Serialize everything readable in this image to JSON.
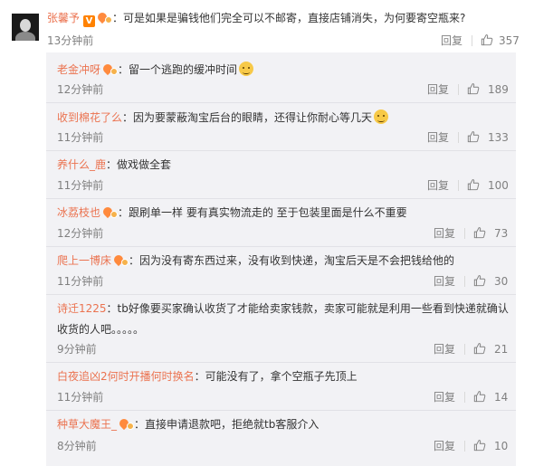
{
  "main": {
    "user": "张馨予",
    "verified_badge": "V",
    "text": "：可是如果是骗钱他们完全可以不邮寄，直接店铺消失，为何要寄空瓶来?",
    "time": "13分钟前",
    "reply_label": "回复",
    "likes": "357"
  },
  "replies": [
    {
      "user": "老金冲呀",
      "fan_badge": true,
      "text": "：留一个逃跑的缓冲时间",
      "emoji": "dog-emoji",
      "time": "12分钟前",
      "reply_label": "回复",
      "likes": "189"
    },
    {
      "user": "收到棉花了么",
      "fan_badge": false,
      "text": "：因为要蒙蔽淘宝后台的眼睛，还得让你耐心等几天",
      "emoji": "laugh-emoji",
      "time": "11分钟前",
      "reply_label": "回复",
      "likes": "133"
    },
    {
      "user": "养什么_鹿",
      "fan_badge": false,
      "text": "：做戏做全套",
      "emoji": null,
      "time": "11分钟前",
      "reply_label": "回复",
      "likes": "100"
    },
    {
      "user": "冰荔枝也",
      "fan_badge": true,
      "text": "：跟刷单一样 要有真实物流走的 至于包装里面是什么不重要",
      "emoji": null,
      "time": "12分钟前",
      "reply_label": "回复",
      "likes": "73"
    },
    {
      "user": "爬上一博床",
      "fan_badge": true,
      "text": "：因为没有寄东西过来，没有收到快递，淘宝后天是不会把钱给他的",
      "emoji": null,
      "time": "11分钟前",
      "reply_label": "回复",
      "likes": "30"
    },
    {
      "user": "诗迁1225",
      "fan_badge": false,
      "text": "：tb好像要买家确认收货了才能给卖家钱款，卖家可能就是利用一些看到快递就确认",
      "text2": "收货的人吧。。。。。",
      "emoji": null,
      "time": "9分钟前",
      "reply_label": "回复",
      "likes": "21"
    },
    {
      "user": "白夜追凶2何时开播何时换名",
      "fan_badge": false,
      "text": "：可能没有了，拿个空瓶子先顶上",
      "emoji": null,
      "time": "11分钟前",
      "reply_label": "回复",
      "likes": "14"
    },
    {
      "user": "种草大魔王_",
      "fan_badge": true,
      "text": "：直接申请退款吧，拒绝就tb客服介入",
      "emoji": null,
      "time": "8分钟前",
      "reply_label": "回复",
      "likes": "10"
    }
  ]
}
